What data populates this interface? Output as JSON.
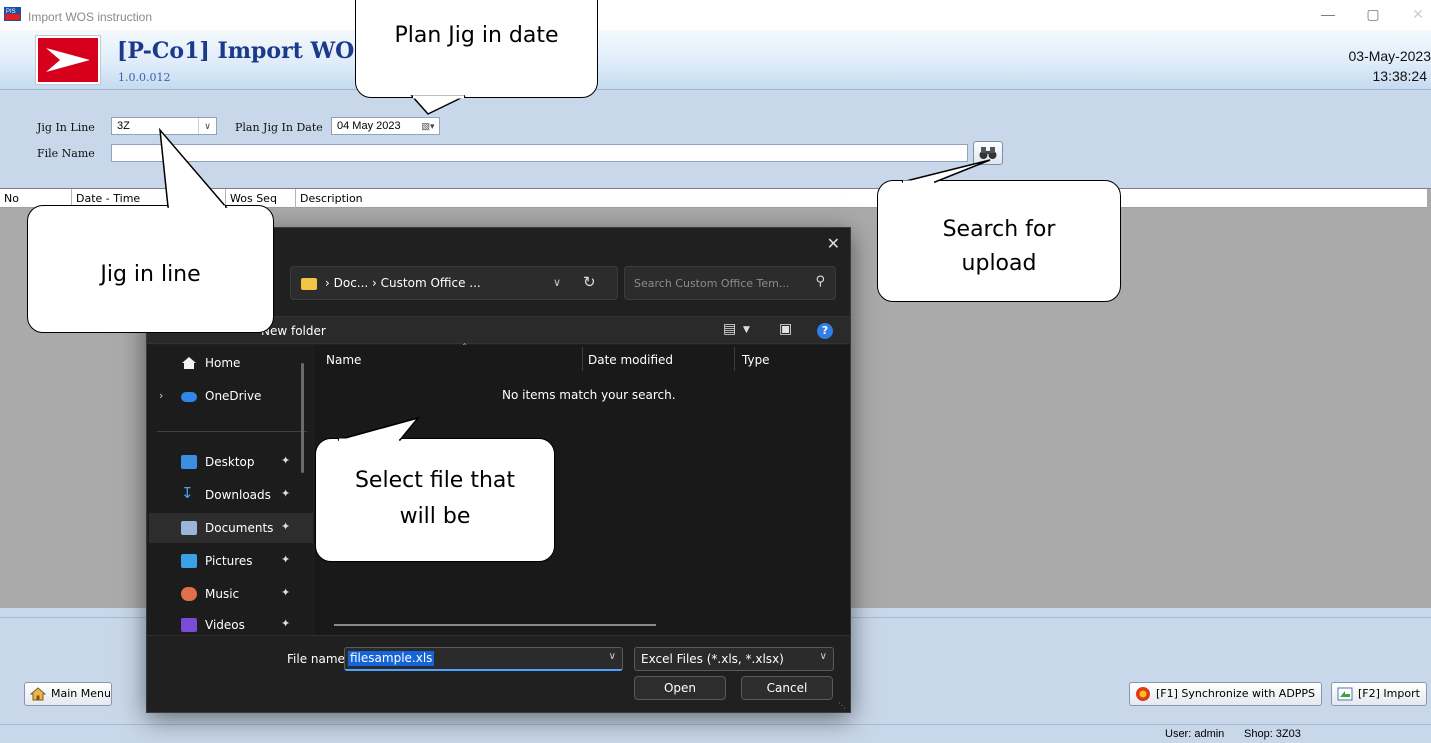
{
  "window": {
    "title": "Import WOS instruction",
    "minimize": "—",
    "maximize": "▢",
    "close": "✕"
  },
  "header": {
    "screen_title": "[P-Co1] Import WOS in",
    "version": "1.0.0.012",
    "date": "03-May-2023",
    "time": "13:38:24"
  },
  "form": {
    "jig_in_line_label": "Jig In Line",
    "jig_in_line_value": "3Z",
    "plan_jig_in_date_label": "Plan Jig In Date",
    "plan_jig_in_date_value": "04 May 2023",
    "file_name_label": "File Name",
    "file_name_value": ""
  },
  "grid": {
    "columns": [
      "No",
      "Date - Time",
      "",
      "Wos Seq",
      "Description"
    ]
  },
  "buttons": {
    "main_menu": "Main Menu",
    "sync": "[F1] Synchronize with ADPPS",
    "import": "[F2] Import"
  },
  "status": {
    "user": "User: admin",
    "shop": "Shop: 3Z03"
  },
  "dialog": {
    "close": "✕",
    "path": "›  Doc...  ›  Custom Office ...",
    "search_placeholder": "Search Custom Office Tem...",
    "new_folder": "New folder",
    "nav_items": [
      {
        "label": "Home",
        "icon": "home-icon"
      },
      {
        "label": "OneDrive",
        "icon": "cloud-icon"
      },
      {
        "label": "Desktop",
        "icon": "desktop-icon"
      },
      {
        "label": "Downloads",
        "icon": "download-icon"
      },
      {
        "label": "Documents",
        "icon": "document-icon"
      },
      {
        "label": "Pictures",
        "icon": "picture-icon"
      },
      {
        "label": "Music",
        "icon": "music-icon"
      },
      {
        "label": "Videos",
        "icon": "video-icon"
      }
    ],
    "columns": {
      "name": "Name",
      "date_modified": "Date modified",
      "type": "Type"
    },
    "empty_message": "No items match your search.",
    "file_name_label": "File name:",
    "file_name_value": "filesample.xls",
    "file_type": "Excel Files (*.xls, *.xlsx)",
    "open": "Open",
    "cancel": "Cancel"
  },
  "callouts": {
    "plan_date": "Plan Jig in date",
    "search_upload_line1": "Search for",
    "search_upload_line2": "upload",
    "jig_line": "Jig in line",
    "select_file_line1": "Select file that",
    "select_file_line2": "will be"
  },
  "colors": {
    "brand_red": "#d6001c",
    "title_blue": "#1b3a8c",
    "panel_blue": "#c8d7e9",
    "dialog_bg": "#202020",
    "selection": "#1664d9"
  }
}
